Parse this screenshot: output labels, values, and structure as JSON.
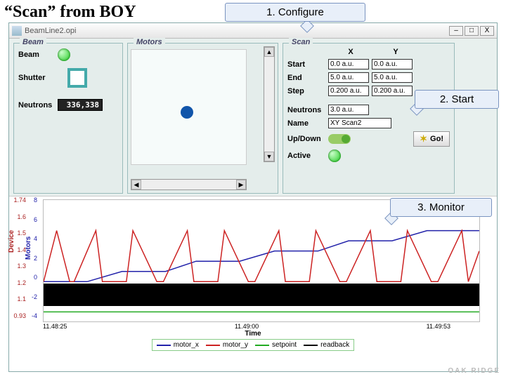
{
  "title": "“Scan” from BOY",
  "callouts": {
    "c1": "1. Configure",
    "c2": "2. Start",
    "c3": "3. Monitor"
  },
  "window": {
    "title": "BeamLine2.opi",
    "btn_min": "–",
    "btn_max": "□",
    "btn_close": "X"
  },
  "beam": {
    "legend": "Beam",
    "beam_label": "Beam",
    "shutter_label": "Shutter",
    "neutrons_label": "Neutrons",
    "neutrons_value": "336,338"
  },
  "motors": {
    "legend": "Motors",
    "up": "▲",
    "down": "▼",
    "left": "◀",
    "right": "▶"
  },
  "scan": {
    "legend": "Scan",
    "col_x": "X",
    "col_y": "Y",
    "start_label": "Start",
    "start_x": "0.0 a.u.",
    "start_y": "0.0 a.u.",
    "end_label": "End",
    "end_x": "5.0 a.u.",
    "end_y": "5.0 a.u.",
    "step_label": "Step",
    "step_x": "0.200 a.u.",
    "step_y": "0.200 a.u.",
    "neutrons_label": "Neutrons",
    "neutrons_val": "3.0 a.u.",
    "name_label": "Name",
    "name_val": "XY Scan2",
    "updown_label": "Up/Down",
    "active_label": "Active",
    "go_label": "Go!"
  },
  "chart_data": {
    "type": "line",
    "title": "",
    "xlabel": "Time",
    "x_ticks": [
      "11.48:25",
      "11.49:00",
      "11.49:53"
    ],
    "left_axis": {
      "label": "Device",
      "color": "#a22",
      "ticks": [
        "1.74",
        "1.6",
        "1.5",
        "1.4",
        "1.3",
        "1.2",
        "1.1",
        "0.93"
      ],
      "range": [
        0.93,
        1.74
      ]
    },
    "right_axis": {
      "label": "Motors",
      "color": "#22a",
      "ticks": [
        "8",
        "6",
        "4",
        "2",
        "0",
        "-2",
        "-4"
      ],
      "range": [
        -4,
        8
      ]
    },
    "series": [
      {
        "name": "motor_x",
        "color": "#22a",
        "axis": "right",
        "x": [
          0,
          0.1,
          0.18,
          0.28,
          0.35,
          0.45,
          0.53,
          0.63,
          0.7,
          0.8,
          0.88,
          0.98,
          1.0
        ],
        "y": [
          0.0,
          0.0,
          1.0,
          1.0,
          2.0,
          2.0,
          3.0,
          3.0,
          4.0,
          4.0,
          5.0,
          5.0,
          5.0
        ]
      },
      {
        "name": "motor_y",
        "color": "#c22",
        "axis": "right",
        "x": [
          0,
          0.03,
          0.06,
          0.07,
          0.12,
          0.135,
          0.19,
          0.205,
          0.26,
          0.275,
          0.33,
          0.345,
          0.4,
          0.415,
          0.47,
          0.485,
          0.54,
          0.555,
          0.61,
          0.625,
          0.68,
          0.695,
          0.75,
          0.765,
          0.82,
          0.835,
          0.89,
          0.905,
          0.96,
          0.975,
          1.0
        ],
        "y": [
          0,
          5,
          0,
          0,
          5,
          0,
          0,
          5,
          0,
          0,
          5,
          0,
          0,
          5,
          0,
          0,
          5,
          0,
          0,
          5,
          0,
          0,
          5,
          0,
          0,
          5,
          0,
          0,
          5,
          0,
          3
        ]
      },
      {
        "name": "setpoint",
        "color": "#2a2",
        "axis": "left",
        "x": [
          0,
          1.0
        ],
        "y": [
          1.0,
          1.0
        ]
      },
      {
        "name": "readback",
        "color": "#000",
        "axis": "left",
        "x": [
          0,
          1.0
        ],
        "y": [
          1.05,
          1.05
        ]
      }
    ]
  },
  "footer": {
    "lab": "OAK RIDGE"
  }
}
